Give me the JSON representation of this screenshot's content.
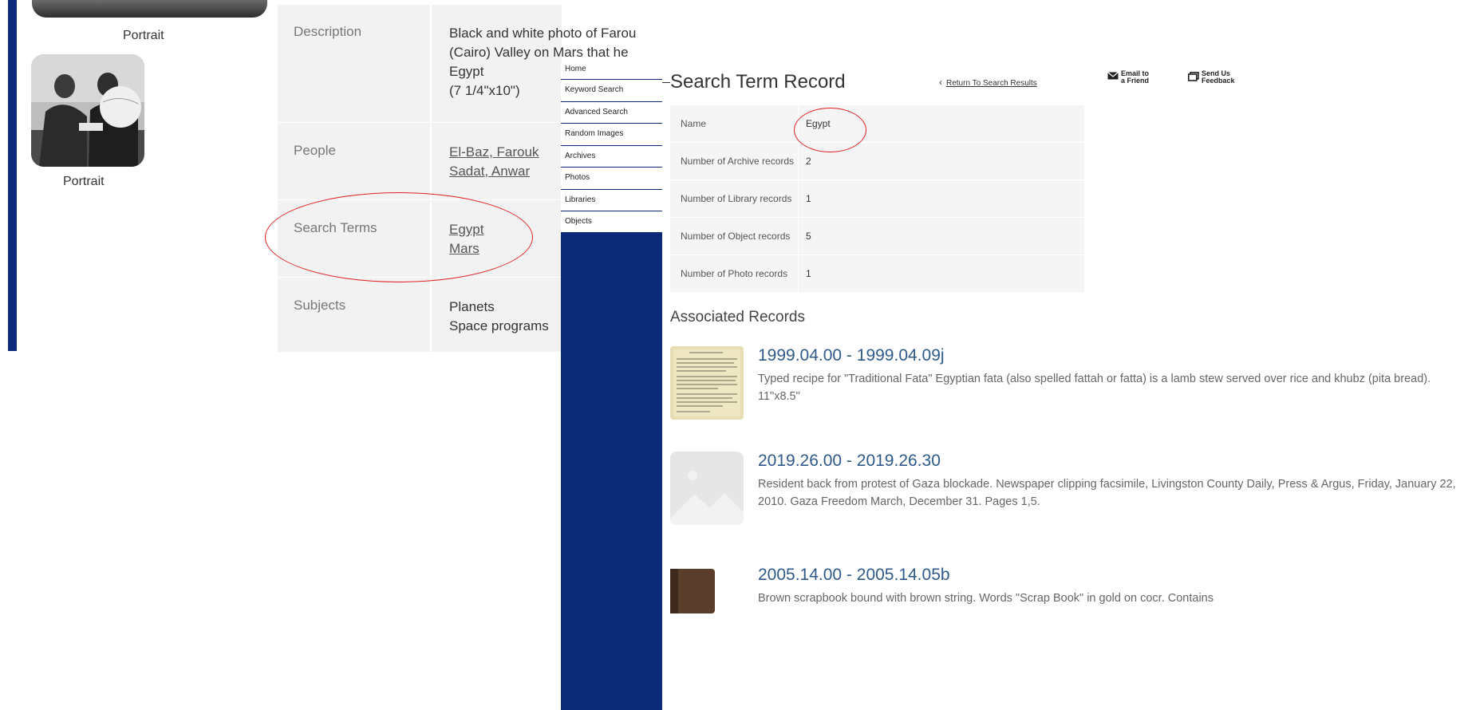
{
  "left_page": {
    "portrait_captions": [
      "Portrait",
      "Portrait"
    ],
    "details": [
      {
        "label": "Description",
        "values": [
          "Black and white photo of Farou",
          "(Cairo) Valley on Mars that he",
          "Egypt",
          "(7 1/4\"x10\")"
        ]
      },
      {
        "label": "People",
        "links": [
          "El-Baz, Farouk",
          "Sadat, Anwar"
        ]
      },
      {
        "label": "Search Terms",
        "links": [
          "Egypt",
          "Mars"
        ]
      },
      {
        "label": "Subjects",
        "values": [
          "Planets",
          "Space programs"
        ]
      }
    ]
  },
  "nav": {
    "items": [
      "Home",
      "Keyword Search",
      "Advanced Search",
      "Random Images",
      "Archives",
      "Photos",
      "Libraries",
      "Objects"
    ]
  },
  "record": {
    "title": "Search Term Record",
    "return_link": "Return To Search Results",
    "email_label": [
      "Email to",
      "a Friend"
    ],
    "feedback_label": [
      "Send Us",
      "Feedback"
    ],
    "rows": [
      {
        "label": "Name",
        "value": "Egypt"
      },
      {
        "label": "Number of Archive records",
        "value": "2"
      },
      {
        "label": "Number of Library records",
        "value": "1"
      },
      {
        "label": "Number of Object records",
        "value": "5"
      },
      {
        "label": "Number of Photo records",
        "value": "1"
      }
    ]
  },
  "associated": {
    "heading": "Associated Records",
    "items": [
      {
        "title": "1999.04.00 - 1999.04.09j",
        "description": "Typed recipe for \"Traditional Fata\" Egyptian fata (also spelled fattah or fatta) is a lamb stew served over rice and khubz (pita bread). 11\"x8.5\""
      },
      {
        "title": "2019.26.00 - 2019.26.30",
        "description": "Resident back from protest of Gaza blockade. Newspaper clipping facsimile, Livingston County Daily, Press & Argus, Friday, January 22, 2010. Gaza Freedom March, December 31. Pages 1,5."
      },
      {
        "title": "2005.14.00 - 2005.14.05b",
        "description": "Brown scrapbook bound with brown string. Words \"Scrap Book\" in gold on cocr. Contains"
      }
    ]
  },
  "colors": {
    "nav_blue": "#0b2a78",
    "link_blue": "#2e5a8a",
    "annotation_red": "#e02020",
    "table_bg": "#f5f5f5"
  }
}
